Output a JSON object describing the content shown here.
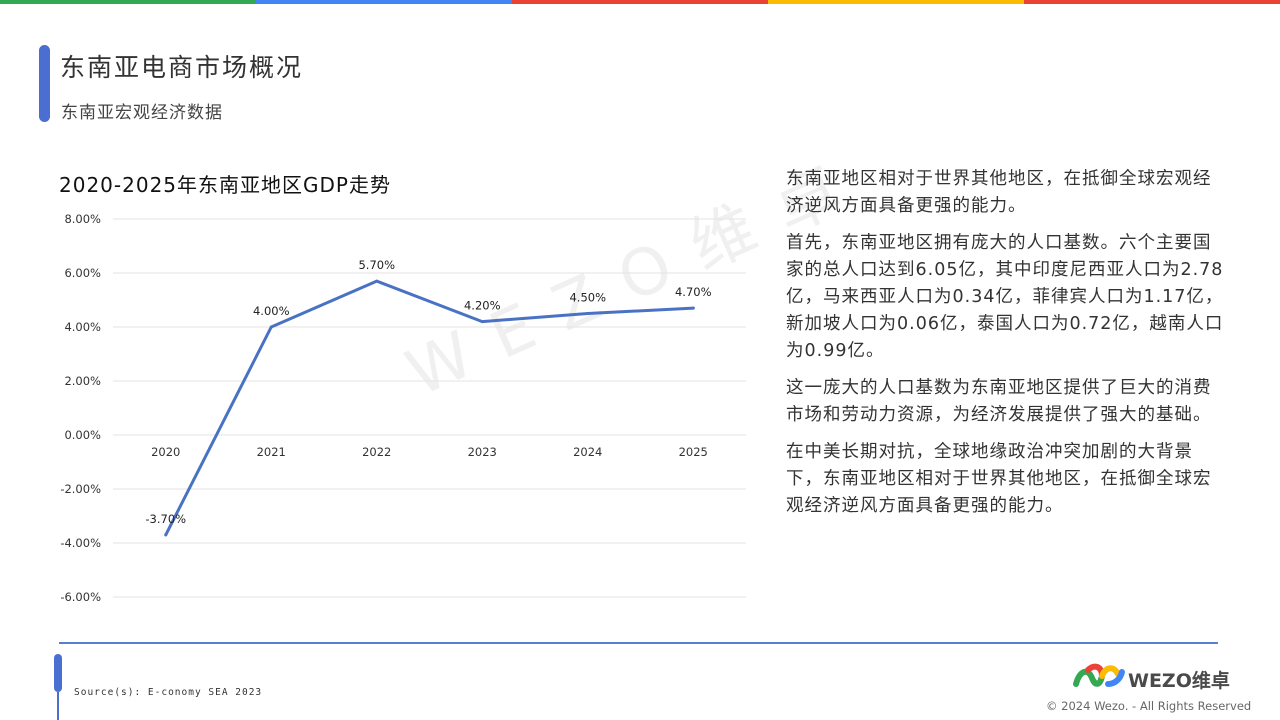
{
  "header": {
    "title": "东南亚电商市场概况",
    "subtitle": "东南亚宏观经济数据"
  },
  "colors": {
    "top_stripes": [
      "#34a853",
      "#4285f4",
      "#ea4335",
      "#fbbc05",
      "#ea4335"
    ],
    "accent": "#4a6fd1",
    "line": "#4a72c4"
  },
  "chart_data": {
    "type": "line",
    "title": "2020-2025年东南亚地区GDP走势",
    "categories": [
      "2020",
      "2021",
      "2022",
      "2023",
      "2024",
      "2025"
    ],
    "values": [
      -3.7,
      4.0,
      5.7,
      4.2,
      4.5,
      4.7
    ],
    "data_labels": [
      "-3.70%",
      "4.00%",
      "5.70%",
      "4.20%",
      "4.50%",
      "4.70%"
    ],
    "ylim": [
      -6,
      8
    ],
    "yticks": [
      8,
      6,
      4,
      2,
      0,
      -2,
      -4,
      -6
    ],
    "ytick_labels": [
      "8.00%",
      "6.00%",
      "4.00%",
      "2.00%",
      "0.00%",
      "-2.00%",
      "-4.00%",
      "-6.00%"
    ],
    "grid": true,
    "xlabel": "",
    "ylabel": ""
  },
  "watermark": "WEZO维卓",
  "paragraphs": [
    "东南亚地区相对于世界其他地区，在抵御全球宏观经济逆风方面具备更强的能力。",
    "首先，东南亚地区拥有庞大的人口基数。六个主要国家的总人口达到6.05亿，其中印度尼西亚人口为2.78亿，马来西亚人口为0.34亿，菲律宾人口为1.17亿，新加坡人口为0.06亿，泰国人口为0.72亿，越南人口为0.99亿。",
    "这一庞大的人口基数为东南亚地区提供了巨大的消费市场和劳动力资源，为经济发展提供了强大的基础。",
    "在中美长期对抗，全球地缘政治冲突加剧的大背景下，东南亚地区相对于世界其他地区，在抵御全球宏观经济逆风方面具备更强的能力。"
  ],
  "footer": {
    "source": "Source(s): E-conomy SEA 2023",
    "logo_text": "WEZO维卓",
    "copyright": "© 2024 Wezo. - All Rights Reserved"
  }
}
